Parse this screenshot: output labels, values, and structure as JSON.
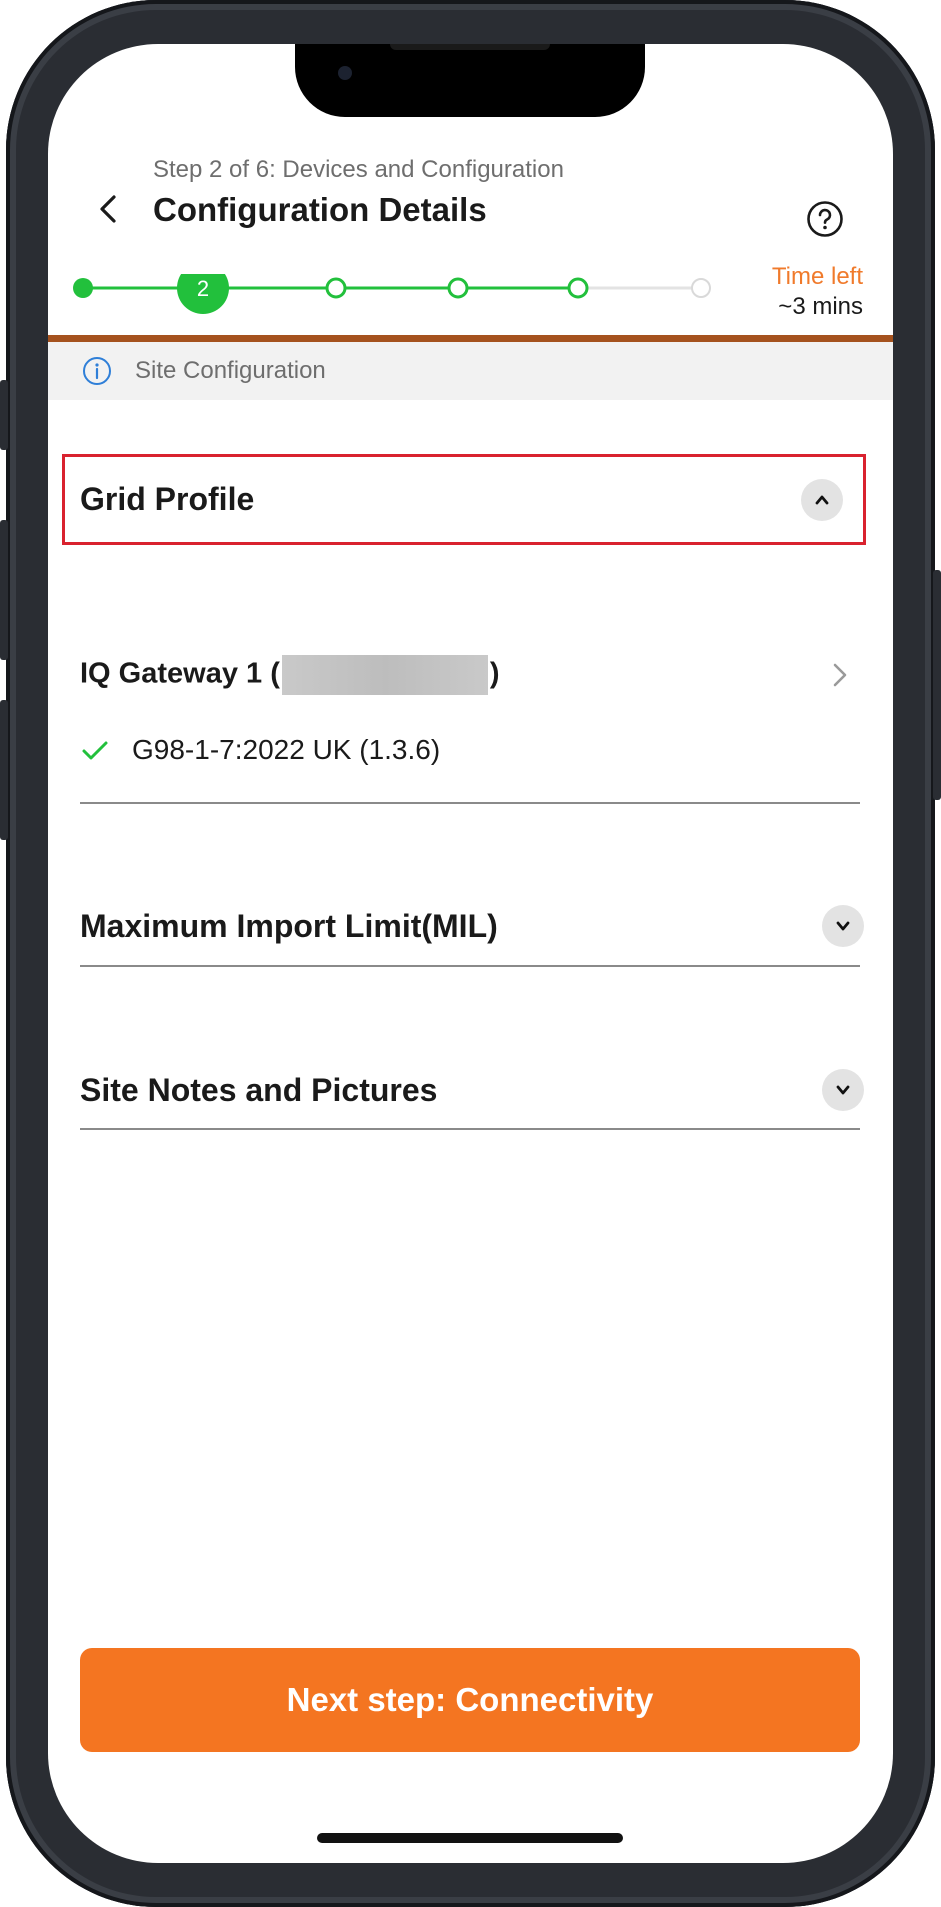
{
  "header": {
    "step_label": "Step 2 of 6: Devices and Configuration",
    "title": "Configuration Details",
    "back_icon": "chevron-left-icon",
    "help_icon": "question-circle-icon"
  },
  "progress": {
    "current_step": 2,
    "total_steps": 6,
    "current_step_label": "2",
    "completed_color": "#22c03c",
    "pending_color": "#d9d9d9",
    "time_left_label": "Time left",
    "time_left_value": "~3 mins"
  },
  "info_banner": {
    "icon": "info-circle-icon",
    "text": "Site Configuration"
  },
  "sections": {
    "grid_profile": {
      "title": "Grid Profile",
      "expanded": true,
      "gateway_label_prefix": "IQ Gateway 1 (",
      "gateway_label_suffix": ")",
      "profile_value": "G98-1-7:2022 UK (1.3.6)"
    },
    "mil": {
      "title": "Maximum Import Limit(MIL)",
      "expanded": false
    },
    "site_notes": {
      "title": "Site Notes and Pictures",
      "expanded": false
    }
  },
  "footer": {
    "next_button_label": "Next step: Connectivity",
    "accent_color": "#f47521"
  }
}
